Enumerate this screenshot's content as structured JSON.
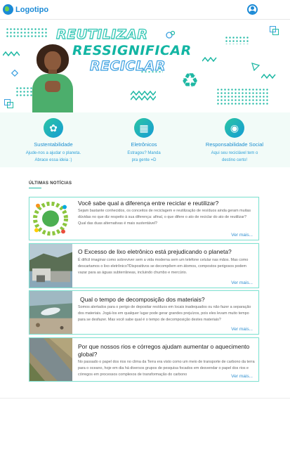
{
  "header": {
    "logo_text": "Logotipo",
    "logo_icon": "globe-icon",
    "user_icon": "user-circle-icon",
    "accent": "#1b8ad6"
  },
  "hero": {
    "line1": "REUTILIZAR",
    "line2": "RESSIGNIFICAR",
    "line3": "RECICLAR",
    "recycle_icon": "recycle-icon",
    "accent": "#1fb8a4"
  },
  "features": [
    {
      "icon": "plant-in-hand-icon",
      "title": "Sustentabilidade",
      "description": "Ajude-nos a ajudar o planeta. Abrace essa ideia :)"
    },
    {
      "icon": "circuit-board-icon",
      "title": "Eletrônicos",
      "description": "Estragou? Manda pra gente =D"
    },
    {
      "icon": "globe-in-hand-icon",
      "title": "Responsabilidade Social",
      "description": "Aqui seu reciclável tem o destino certo!"
    }
  ],
  "news": {
    "section_title": "ÚLTIMAS NOTÍCIAS",
    "more_label": "Ver mais...",
    "items": [
      {
        "title": "Você sabe qual a diferença entre reciclar e reutilizar?",
        "text": "Sejam bastante conhecidos, os conceitos de reciclagem e reutilização de resíduos ainda geram muitas dúvidas no que diz respeito à sua diferença: afinal, o que difere o ato de reciclar do ato de reutilizar? Qual das duas alternativas é mais sustentável?",
        "more": "Ver mais..."
      },
      {
        "title": "O Excesso de lixo eletrônico está prejudicando o planeta?",
        "text": "É difícil imaginar como sobreviver sem a vida moderna sem um telefone celular nas mãos. Mas como descartamos o lixo eletrônico?Dispositivos se decompõem em átomos, compostos perigosos podem vazar para as águas subterrâneas, incluindo chumbo e mercúrio.",
        "more": "Ver mais..."
      },
      {
        "title": "Qual o tempo de decomposição dos materiais?",
        "text": "Somos alertados para o perigo de depositar resíduos em locais inadequados ou não fazer a separação dos materiais. Jogá-los em qualquer lugar pode gerar grandes prejuízos, pois eles levam muito tempo para se desfazer. Mas você sabe qual é o tempo de decomposição destes materiais?",
        "more": "Ver mais..."
      },
      {
        "title": "Por que nossos rios e córregos ajudam aumentar o aquecimento global?",
        "text": "No passado o papel dos rios no clima da Terra era visto como um meio de transporte de carbono da terra para o oceano, hoje em dia há diversos grupos de pesquisa focados em desvendar o papel dos rios e córregos em processos complexos de transformação do carbono",
        "more": "Ver mais..."
      }
    ]
  }
}
